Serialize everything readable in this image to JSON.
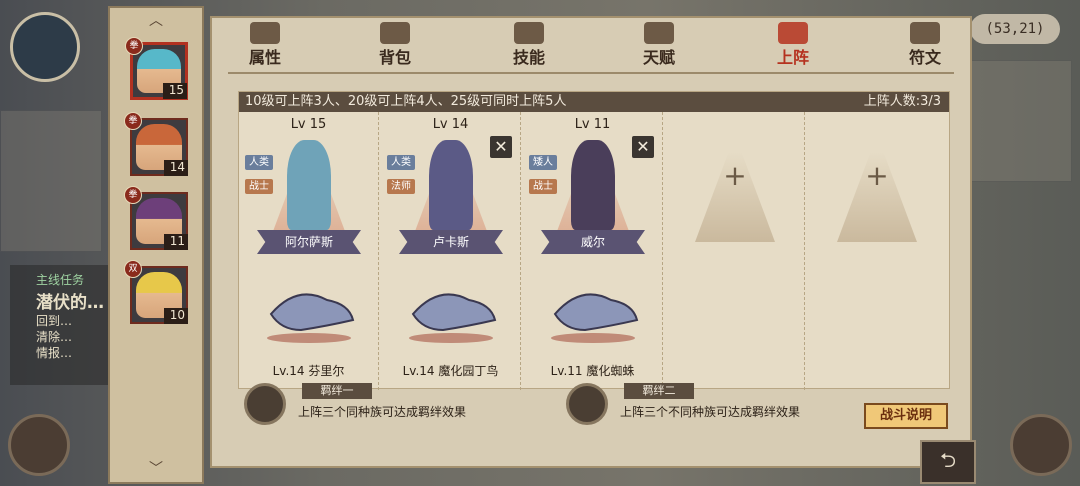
{
  "hud": {
    "coords": "(53,21)"
  },
  "tabs": [
    {
      "label": "属性",
      "icon": "flame-icon",
      "active": false
    },
    {
      "label": "背包",
      "icon": "bag-icon",
      "active": false
    },
    {
      "label": "技能",
      "icon": "book-icon",
      "active": false
    },
    {
      "label": "天赋",
      "icon": "eye-icon",
      "active": false
    },
    {
      "label": "上阵",
      "icon": "crossed-swords-icon",
      "active": true
    },
    {
      "label": "符文",
      "icon": "rune-icon",
      "active": false
    }
  ],
  "roster": [
    {
      "level": "15",
      "emblem": "拳",
      "hair": "#57b8c9"
    },
    {
      "level": "14",
      "emblem": "拳",
      "hair": "#c9673a"
    },
    {
      "level": "11",
      "emblem": "拳",
      "hair": "#6d3f7a"
    },
    {
      "level": "10",
      "emblem": "双",
      "hair": "#e7c84a"
    }
  ],
  "lineup": {
    "rule_text": "10级可上阵3人、20级可上阵4人、25级可同时上阵5人",
    "count_text": "上阵人数:3/3",
    "slots": [
      {
        "level": "Lv 15",
        "race": "人类",
        "class": "战士",
        "name": "阿尔萨斯",
        "pet": "Lv.14 芬里尔",
        "color": "#6fa3b8"
      },
      {
        "level": "Lv 14",
        "race": "人类",
        "class": "法师",
        "name": "卢卡斯",
        "pet": "Lv.14 魔化园丁鸟",
        "color": "#5b5a86"
      },
      {
        "level": "Lv 11",
        "race": "矮人",
        "class": "战士",
        "name": "威尔",
        "pet": "Lv.11 魔化蜘蛛",
        "color": "#4a3e5a"
      },
      {
        "empty": true,
        "plus": "+"
      },
      {
        "empty": true,
        "plus": "+"
      }
    ]
  },
  "bonds": [
    {
      "title": "羁绊一",
      "desc": "上阵三个同种族可达成羁绊效果"
    },
    {
      "title": "羁绊二",
      "desc": "上阵三个不同种族可达成羁绊效果"
    }
  ],
  "buttons": {
    "battle_help": "战斗说明",
    "close": "✕"
  }
}
